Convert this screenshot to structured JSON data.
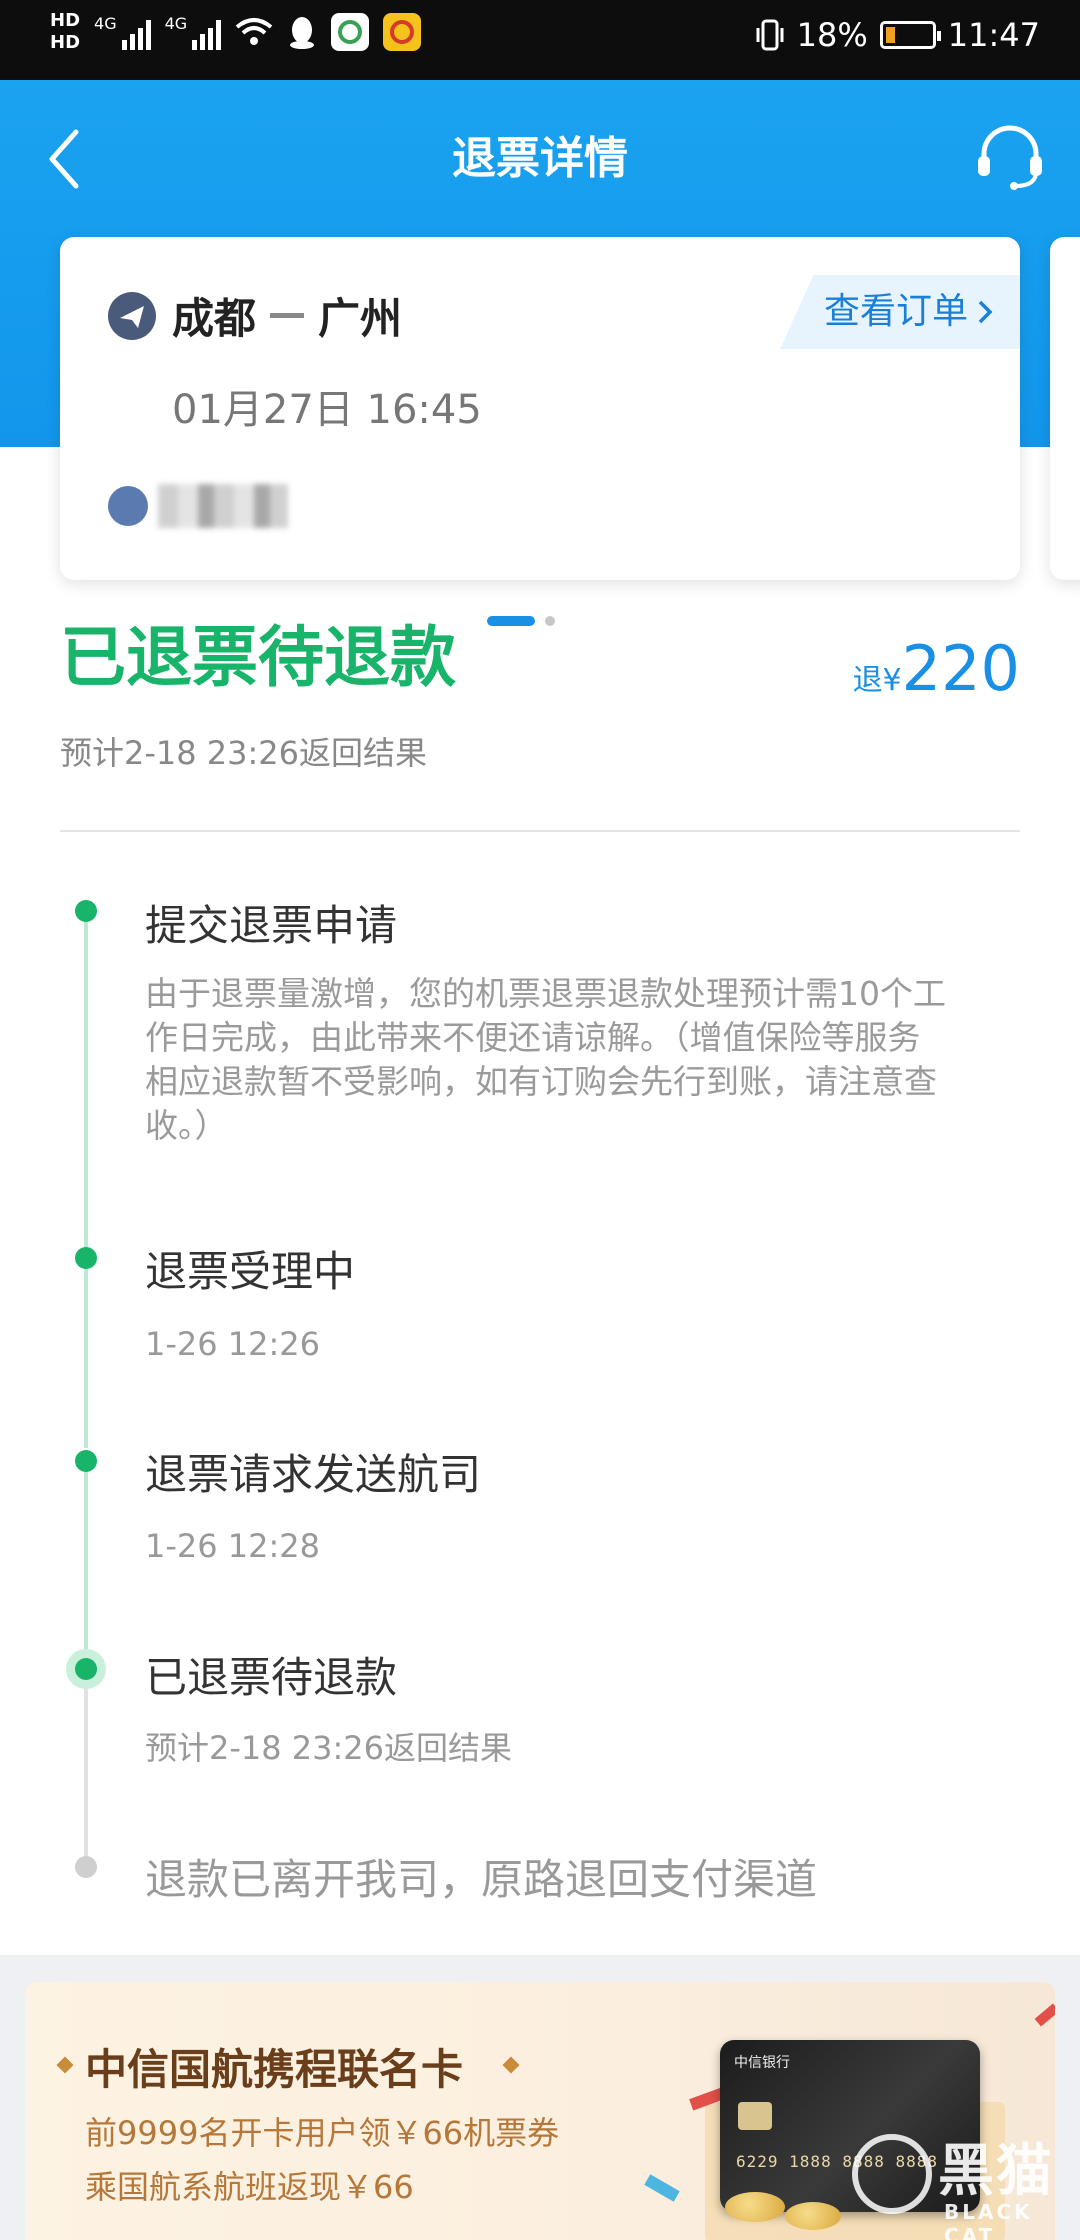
{
  "status_bar": {
    "hd1": "HD",
    "hd2": "HD",
    "sig1_label": "4G",
    "sig2_label": "4G",
    "battery_percent": "18%",
    "time": "11:47"
  },
  "header": {
    "title": "退票详情",
    "back_icon": "chevron-left-icon",
    "service_icon": "headset-icon"
  },
  "flight": {
    "from": "成都",
    "to": "广州",
    "datetime": "01月27日 16:45",
    "order_link": "查看订单"
  },
  "status": {
    "title": "已退票待退款",
    "refund_prefix": "退¥",
    "refund_amount": "220",
    "eta": "预计2-18 23:26返回结果"
  },
  "timeline": [
    {
      "title": "提交退票申请",
      "desc_lines": [
        "由于退票量激增，您的机票退票退款处理预计需10个工",
        "作日完成，由此带来不便还请谅解。（增值保险等服务",
        "相应退款暂不受影响，如有订购会先行到账，请注意查",
        "收。）"
      ]
    },
    {
      "title": "退票受理中",
      "time": "1-26 12:26"
    },
    {
      "title": "退票请求发送航司",
      "time": "1-26 12:28"
    },
    {
      "title": "已退票待退款",
      "time": "预计2-18 23:26返回结果"
    },
    {
      "title": "退款已离开我司，原路退回支付渠道"
    }
  ],
  "promo": {
    "title": "中信国航携程联名卡",
    "line1": "前9999名开卡用户领￥66机票券",
    "line2": "乘国航系航班返现￥66",
    "card_number": "6229 1888 8888 8888",
    "card_bank": "中信银行"
  },
  "watermark": {
    "text": "黑猫",
    "sub": "BLACK CAT"
  },
  "colors": {
    "header_blue": "#1296ec",
    "success_green": "#17b46a",
    "link_blue": "#1a7fd8"
  }
}
